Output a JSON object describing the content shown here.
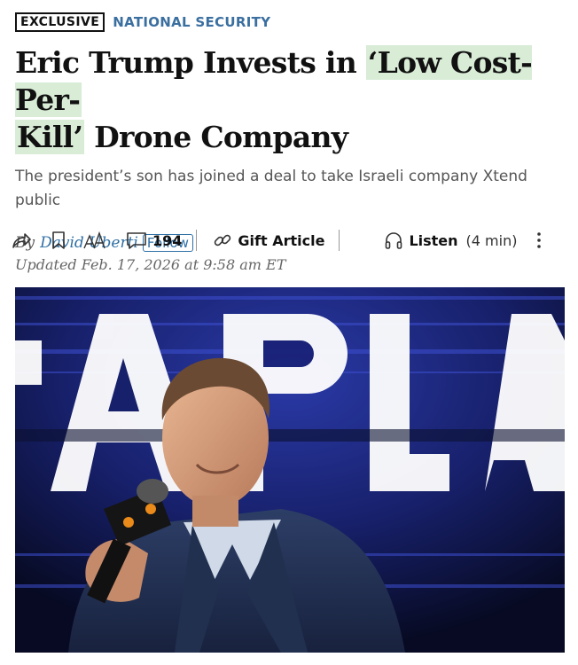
{
  "article": {
    "flag": "EXCLUSIVE",
    "section": "NATIONAL SECURITY",
    "headline_part1": "Eric Trump Invests in ",
    "headline_highlight1": "‘Low Cost-Per-",
    "headline_highlight2": "Kill’",
    "headline_part2": " Drone Company",
    "dek": "The president’s son has joined a deal to take Israeli company Xtend public",
    "byline_prefix": "By",
    "author": "David Uberti",
    "follow_label": "Follow",
    "updated": "Updated Feb. 17, 2026 at 9:58 am ET"
  },
  "toolbar": {
    "share_icon": "share-icon",
    "bookmark_icon": "bookmark-icon",
    "text_size_icon": "text-size-icon",
    "comment_icon": "comment-icon",
    "comment_count": "194",
    "gift_label": "Gift Article",
    "listen_label": "Listen",
    "listen_duration": "(4 min)"
  },
  "photo": {
    "description_icon": "photo-eric-trump-speaking"
  },
  "colors": {
    "highlight": "#d8ecd6",
    "link_blue": "#2f6fa4",
    "section_blue": "#3a6fa0"
  }
}
